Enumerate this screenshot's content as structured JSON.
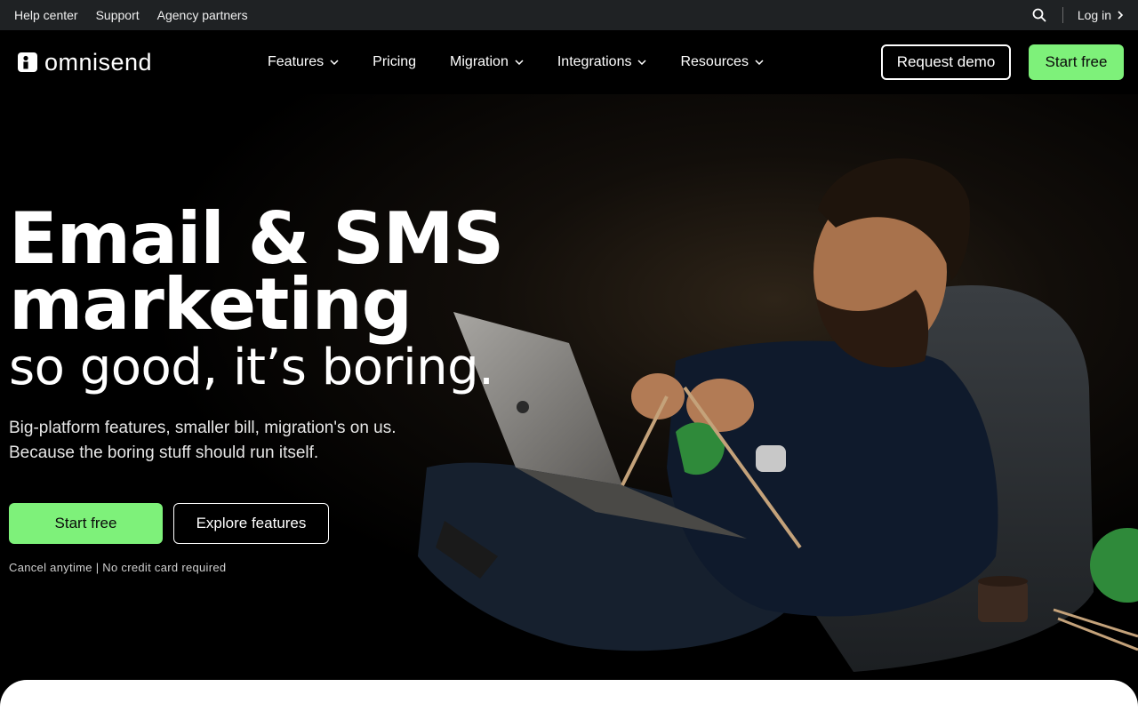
{
  "utility_bar": {
    "links": [
      "Help center",
      "Support",
      "Agency partners"
    ],
    "login_label": "Log in"
  },
  "nav": {
    "logo_text": "omnisend",
    "items": [
      {
        "label": "Features",
        "has_dropdown": true
      },
      {
        "label": "Pricing",
        "has_dropdown": false
      },
      {
        "label": "Migration",
        "has_dropdown": true
      },
      {
        "label": "Integrations",
        "has_dropdown": true
      },
      {
        "label": "Resources",
        "has_dropdown": true
      }
    ],
    "request_demo_label": "Request demo",
    "start_free_label": "Start free"
  },
  "hero": {
    "headline_line1": "Email & SMS",
    "headline_line2": "marketing",
    "headline_line3": "so good, it’s boring.",
    "subcopy_line1": "Big-platform features, smaller bill, migration's on us.",
    "subcopy_line2": "Because the boring stuff should run itself.",
    "cta_start_label": "Start free",
    "cta_explore_label": "Explore features",
    "fine_print": "Cancel anytime | No credit card required"
  },
  "colors": {
    "accent_green": "#7ef17a",
    "utility_bar_bg": "#1f2224",
    "page_bg": "#000000"
  },
  "icons": {
    "search": "search-icon",
    "login_chevron": "chevron-right-icon",
    "dropdown": "chevron-down-icon",
    "logo": "omnisend-logo-icon"
  }
}
